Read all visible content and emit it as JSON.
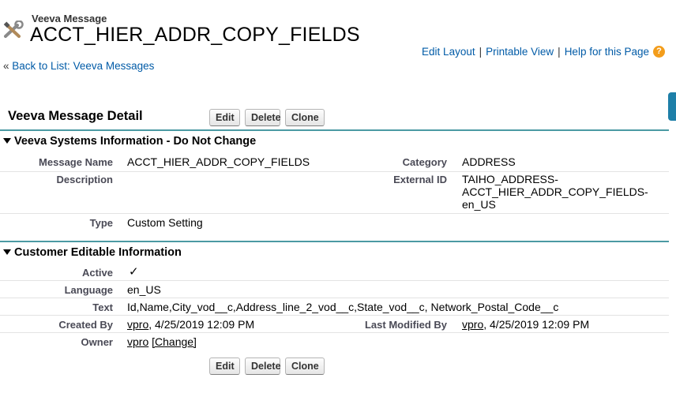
{
  "header": {
    "object_type": "Veeva Message",
    "record_title": "ACCT_HIER_ADDR_COPY_FIELDS",
    "object_icon": "tools-icon",
    "links": {
      "edit_layout": "Edit Layout",
      "printable_view": "Printable View",
      "help": "Help for this Page",
      "separator": "|"
    },
    "back_prefix": "«",
    "back_link": "Back to List: Veeva Messages"
  },
  "detail": {
    "title": "Veeva Message Detail",
    "buttons": {
      "edit": "Edit",
      "delete": "Delete",
      "clone": "Clone"
    }
  },
  "section_system": {
    "title": "Veeva Systems Information - Do Not Change",
    "message_name_label": "Message Name",
    "message_name": "ACCT_HIER_ADDR_COPY_FIELDS",
    "category_label": "Category",
    "category": "ADDRESS",
    "description_label": "Description",
    "description": "",
    "external_id_label": "External ID",
    "external_id_line1": "TAIHO_ADDRESS-",
    "external_id_line2": "ACCT_HIER_ADDR_COPY_FIELDS-",
    "external_id_line3": "en_US",
    "type_label": "Type",
    "type": "Custom Setting"
  },
  "section_customer": {
    "title": "Customer Editable Information",
    "active_label": "Active",
    "active": "✓",
    "language_label": "Language",
    "language": "en_US",
    "text_label": "Text",
    "text": "Id,Name,City_vod__c,Address_line_2_vod__c,State_vod__c, Network_Postal_Code__c",
    "created_by_label": "Created By",
    "created_by_user": "vpro",
    "created_by_date": ", 4/25/2019 12:09 PM",
    "last_modified_label": "Last Modified By",
    "last_modified_user": "vpro",
    "last_modified_date": ", 4/25/2019 12:09 PM",
    "owner_label": "Owner",
    "owner_user": "vpro",
    "owner_change": "[Change]"
  },
  "colors": {
    "accent_rule": "#4b9aa3",
    "link": "#015ba7",
    "help_icon": "#f39d1b"
  }
}
